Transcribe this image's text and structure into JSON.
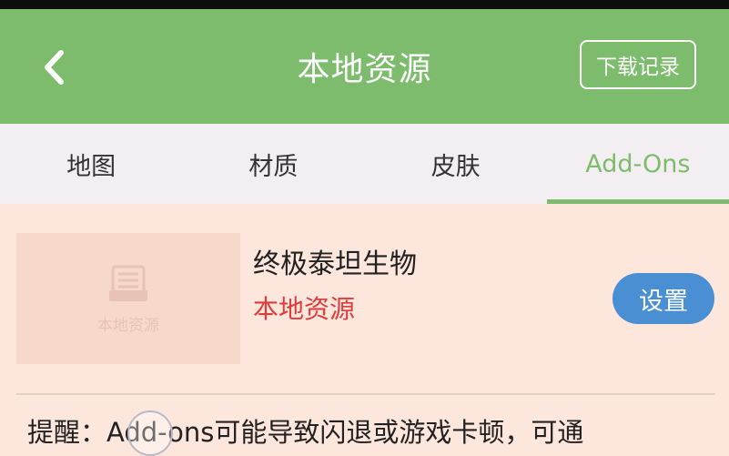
{
  "header": {
    "title": "本地资源",
    "download_record_label": "下载记录",
    "back_icon": "chevron-left-icon",
    "background_color": "#7cbc6c"
  },
  "tabs": [
    {
      "label": "地图",
      "active": false
    },
    {
      "label": "材质",
      "active": false
    },
    {
      "label": "皮肤",
      "active": false
    },
    {
      "label": "Add-Ons",
      "active": true
    }
  ],
  "resource": {
    "thumbnail_text": "本地资源",
    "thumbnail_icon": "archive-box-icon",
    "name": "终极泰坦生物",
    "status": "本地资源",
    "status_color": "#e03b3b",
    "settings_label": "设置",
    "settings_color": "#4a8fd4"
  },
  "notice": {
    "text": "提醒：Add-ons可能导致闪退或游戏卡顿，可通"
  }
}
